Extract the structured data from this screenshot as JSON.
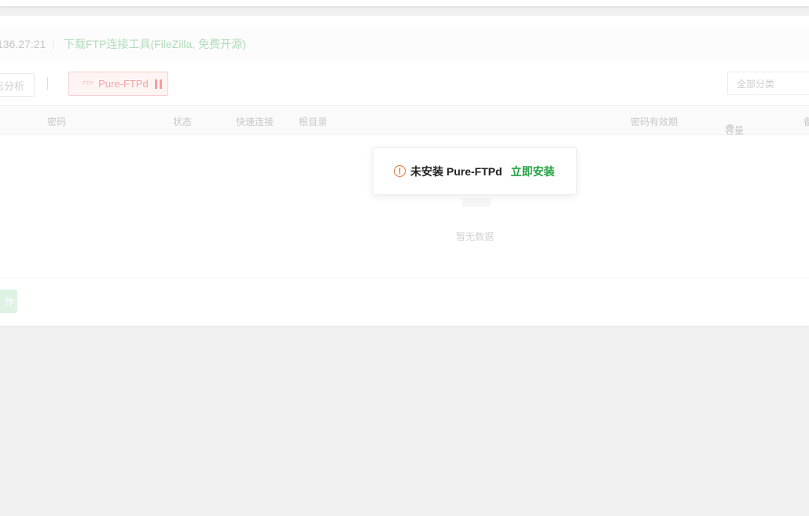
{
  "info_bar": {
    "ip_fragment": "136.27:21",
    "separator": "|",
    "download_link": "下载FTP连接工具(FileZilla, 免费开源)"
  },
  "toolbar": {
    "analyze_label": "志分析",
    "service_name": "Pure-FTPd",
    "service_icon_text": "FTP",
    "category_select_value": "全部分类"
  },
  "table": {
    "columns": [
      "密码",
      "状态",
      "快速连接",
      "根目录",
      "密码有效期",
      "容量",
      "备"
    ],
    "empty_text": "暂无数据"
  },
  "footer": {
    "batch_button_label": "作"
  },
  "toast": {
    "message": "未安装 Pure-FTPd",
    "action_label": "立即安装"
  },
  "colors": {
    "accent_green": "#21a340",
    "warning_orange": "#e46f2a",
    "stopped_red": "#f29f9f"
  }
}
